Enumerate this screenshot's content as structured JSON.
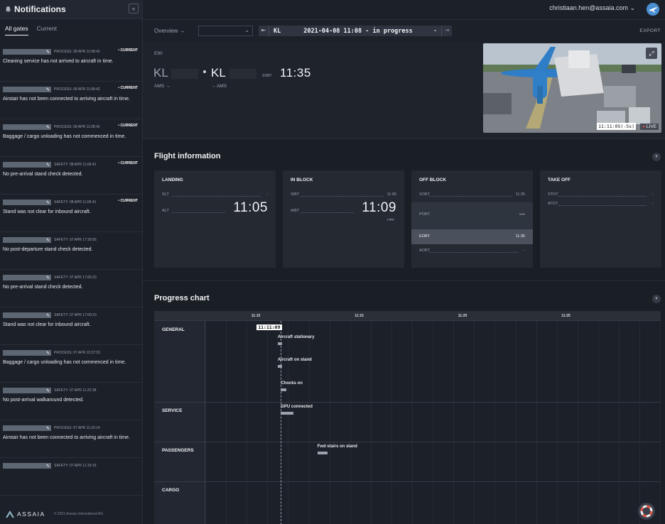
{
  "sidebar": {
    "title": "Notifications",
    "tabs": [
      "All gates",
      "Current"
    ],
    "notifications": [
      {
        "meta": "PROCESS: 08 APR 11:08:42",
        "current": "• CURRENT",
        "message": "Cleaning service has not arrived to aircraft in time."
      },
      {
        "meta": "PROCESS: 08 APR 11:08:42",
        "current": "• CURRENT",
        "message": "Airstair has not been connected to arriving aircraft in time."
      },
      {
        "meta": "PROCESS: 08 APR 11:08:42",
        "current": "• CURRENT",
        "message": "Baggage / cargo unloading has not commenced in time."
      },
      {
        "meta": "SAFETY: 08 APR 11:06:41",
        "current": "• CURRENT",
        "message": "No pre-arrival stand check detected."
      },
      {
        "meta": "SAFETY: 08 APR 11:06:41",
        "current": "• CURRENT",
        "message": "Stand was not clear for inbound aircraft."
      },
      {
        "meta": "SAFETY: 07 APR 17:39:56",
        "current": "",
        "message": "No post-departure stand check detected."
      },
      {
        "meta": "SAFETY: 07 APR 17:00:23",
        "current": "",
        "message": "No pre-arrival stand check detected."
      },
      {
        "meta": "SAFETY: 07 APR 17:00:23",
        "current": "",
        "message": "Stand was not clear for inbound aircraft."
      },
      {
        "meta": "PROCESS: 07 APR 12:37:53",
        "current": "",
        "message": "Baggage / cargo unloading has not commenced in time."
      },
      {
        "meta": "SAFETY: 07 APR 11:22:38",
        "current": "",
        "message": "No post-arrival walkaround detected."
      },
      {
        "meta": "PROCESS: 07 APR 11:20:14",
        "current": "",
        "message": "Airstair has not been connected to arriving aircraft in time."
      },
      {
        "meta": "SAFETY: 07 APR 11:19:19",
        "current": "",
        "message": ""
      }
    ],
    "brand": "ASSAIA",
    "copyright": "© 2021 Assaia International AG"
  },
  "topbar": {
    "user_email": "christiaan.hen@assaia.com ⌄"
  },
  "toolbar": {
    "overview": "Overview →",
    "flight_code": "KL",
    "flight_status": "2021-04-08 11:08 - in progress",
    "export": "EXPORT"
  },
  "flight": {
    "aircraft_type": "E90",
    "arr_code": "KL",
    "dep_code": "KL",
    "arr_sub": "AMS →",
    "dep_sub": "→ AMS",
    "sobt_label": "SOBT",
    "sobt_value": "11:35",
    "camera_time": "11:11:05(-5s)",
    "camera_live": "LIVE"
  },
  "flight_info": {
    "title": "Flight information",
    "cards": [
      {
        "title": "LANDING",
        "rows": [
          {
            "k": "SLT",
            "v": "-"
          },
          {
            "k": "ALT",
            "big": "11:05"
          }
        ]
      },
      {
        "title": "IN BLOCK",
        "rows": [
          {
            "k": "SIBT",
            "v": "11:05"
          },
          {
            "k": "AIBT",
            "big": "11:09",
            "delta": "+4m"
          }
        ]
      },
      {
        "title": "OFF BLOCK",
        "rows": [
          {
            "k": "SOBT",
            "v": "11:35"
          },
          {
            "k": "POBT",
            "v": "—"
          },
          {
            "k": "EOBT",
            "v": "11:35"
          },
          {
            "k": "AOBT",
            "v": "-"
          }
        ]
      },
      {
        "title": "TAKE OFF",
        "rows": [
          {
            "k": "STOT",
            "v": "-"
          },
          {
            "k": "ATOT",
            "v": "-"
          }
        ]
      }
    ]
  },
  "progress": {
    "title": "Progress chart",
    "ticks": [
      "11:10",
      "11:15",
      "11:20",
      "11:25"
    ],
    "now_label": "11:11:09",
    "groups": [
      "GENERAL",
      "SERVICE",
      "PASSENGERS",
      "CARGO"
    ],
    "bars": [
      {
        "label": "Aircraft stationary",
        "start": "11:11:00",
        "end": "11:11:09"
      },
      {
        "label": "Aircraft on stand",
        "start": "11:11:00",
        "end": "11:11:09"
      },
      {
        "label": "Chocks on",
        "start": "11:11:25",
        "end": "11:11:09"
      },
      {
        "label": "GPU connected",
        "start": "11:11:45",
        "end": "11:11:09"
      },
      {
        "label": "Fwd stairs on stand",
        "start": "11:12:55",
        "end": "11:13:25"
      }
    ]
  },
  "colors": {
    "accent": "#4a8fd1",
    "live": "#e14a3b",
    "background": "#1a1e25"
  }
}
